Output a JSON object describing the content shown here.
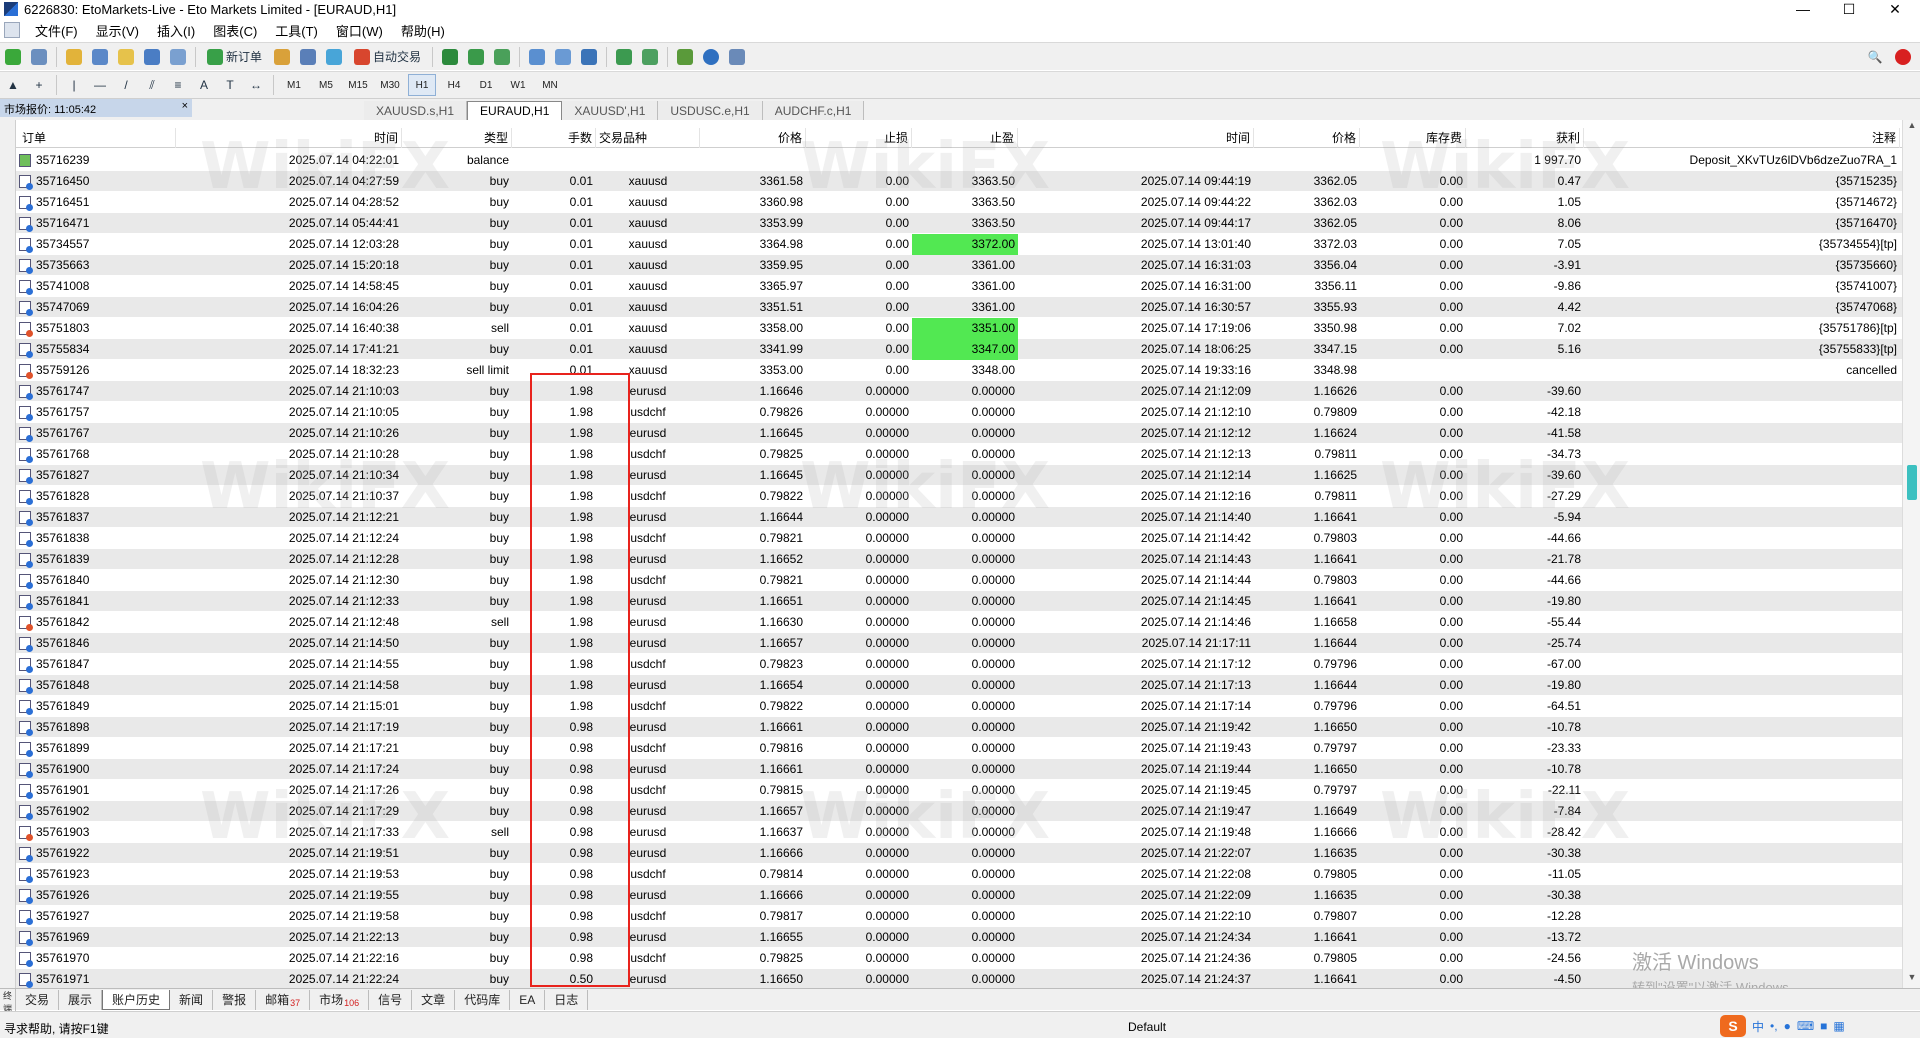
{
  "window": {
    "title": "6226830: EtoMarkets-Live - Eto Markets Limited - [EURAUD,H1]",
    "controls": [
      "—",
      "☐",
      "✕"
    ]
  },
  "menu": [
    "文件(F)",
    "显示(V)",
    "插入(I)",
    "图表(C)",
    "工具(T)",
    "窗口(W)",
    "帮助(H)"
  ],
  "toolbar": {
    "new_order": "新订单",
    "auto_trade": "自动交易",
    "timeframes": [
      "M1",
      "M5",
      "M15",
      "M30",
      "H1",
      "H4",
      "D1",
      "W1",
      "MN"
    ],
    "active_timeframe": "H1"
  },
  "market_watch": {
    "header": "市场报价: 11:05:42",
    "close": "×"
  },
  "chart_tabs": [
    "XAUUSD.s,H1",
    "EURAUD,H1",
    "XAUUSD',H1",
    "USDUSC.e,H1",
    "AUDCHF.c,H1"
  ],
  "active_chart_tab": "EURAUD,H1",
  "columns": [
    "订单",
    "时间",
    "类型",
    "手数",
    "交易品种",
    "价格",
    "止损",
    "止盈",
    "时间",
    "价格",
    "库存费",
    "获利",
    "注释"
  ],
  "rows": [
    {
      "order": "35716239",
      "open_time": "2025.07.14 04:22:01",
      "type": "balance",
      "lots": "",
      "symbol": "",
      "price": "",
      "sl": "",
      "tp": "",
      "close_time": "",
      "close_price": "",
      "swap": "",
      "profit": "1 997.70",
      "comment": "Deposit_XKvTUz6lDVb6dzeZuo7RA_1",
      "icon": "bal"
    },
    {
      "order": "35716450",
      "open_time": "2025.07.14 04:27:59",
      "type": "buy",
      "lots": "0.01",
      "symbol": "xauusd",
      "price": "3361.58",
      "sl": "0.00",
      "tp": "3363.50",
      "close_time": "2025.07.14 09:44:19",
      "close_price": "3362.05",
      "swap": "0.00",
      "profit": "0.47",
      "comment": "{35715235}",
      "icon": "buy"
    },
    {
      "order": "35716451",
      "open_time": "2025.07.14 04:28:52",
      "type": "buy",
      "lots": "0.01",
      "symbol": "xauusd",
      "price": "3360.98",
      "sl": "0.00",
      "tp": "3363.50",
      "close_time": "2025.07.14 09:44:22",
      "close_price": "3362.03",
      "swap": "0.00",
      "profit": "1.05",
      "comment": "{35714672}",
      "icon": "buy"
    },
    {
      "order": "35716471",
      "open_time": "2025.07.14 05:44:41",
      "type": "buy",
      "lots": "0.01",
      "symbol": "xauusd",
      "price": "3353.99",
      "sl": "0.00",
      "tp": "3363.50",
      "close_time": "2025.07.14 09:44:17",
      "close_price": "3362.05",
      "swap": "0.00",
      "profit": "8.06",
      "comment": "{35716470}",
      "icon": "buy"
    },
    {
      "order": "35734557",
      "open_time": "2025.07.14 12:03:28",
      "type": "buy",
      "lots": "0.01",
      "symbol": "xauusd",
      "price": "3364.98",
      "sl": "0.00",
      "tp": "3372.00",
      "close_time": "2025.07.14 13:01:40",
      "close_price": "3372.03",
      "swap": "0.00",
      "profit": "7.05",
      "comment": "{35734554}[tp]",
      "icon": "buy",
      "tp_hit": true
    },
    {
      "order": "35735663",
      "open_time": "2025.07.14 15:20:18",
      "type": "buy",
      "lots": "0.01",
      "symbol": "xauusd",
      "price": "3359.95",
      "sl": "0.00",
      "tp": "3361.00",
      "close_time": "2025.07.14 16:31:03",
      "close_price": "3356.04",
      "swap": "0.00",
      "profit": "-3.91",
      "comment": "{35735660}",
      "icon": "buy"
    },
    {
      "order": "35741008",
      "open_time": "2025.07.14 14:58:45",
      "type": "buy",
      "lots": "0.01",
      "symbol": "xauusd",
      "price": "3365.97",
      "sl": "0.00",
      "tp": "3361.00",
      "close_time": "2025.07.14 16:31:00",
      "close_price": "3356.11",
      "swap": "0.00",
      "profit": "-9.86",
      "comment": "{35741007}",
      "icon": "buy"
    },
    {
      "order": "35747069",
      "open_time": "2025.07.14 16:04:26",
      "type": "buy",
      "lots": "0.01",
      "symbol": "xauusd",
      "price": "3351.51",
      "sl": "0.00",
      "tp": "3361.00",
      "close_time": "2025.07.14 16:30:57",
      "close_price": "3355.93",
      "swap": "0.00",
      "profit": "4.42",
      "comment": "{35747068}",
      "icon": "buy"
    },
    {
      "order": "35751803",
      "open_time": "2025.07.14 16:40:38",
      "type": "sell",
      "lots": "0.01",
      "symbol": "xauusd",
      "price": "3358.00",
      "sl": "0.00",
      "tp": "3351.00",
      "close_time": "2025.07.14 17:19:06",
      "close_price": "3350.98",
      "swap": "0.00",
      "profit": "7.02",
      "comment": "{35751786}[tp]",
      "icon": "sell",
      "tp_hit": true
    },
    {
      "order": "35755834",
      "open_time": "2025.07.14 17:41:21",
      "type": "buy",
      "lots": "0.01",
      "symbol": "xauusd",
      "price": "3341.99",
      "sl": "0.00",
      "tp": "3347.00",
      "close_time": "2025.07.14 18:06:25",
      "close_price": "3347.15",
      "swap": "0.00",
      "profit": "5.16",
      "comment": "{35755833}[tp]",
      "icon": "buy",
      "tp_hit": true
    },
    {
      "order": "35759126",
      "open_time": "2025.07.14 18:32:23",
      "type": "sell limit",
      "lots": "0.01",
      "symbol": "xauusd",
      "price": "3353.00",
      "sl": "0.00",
      "tp": "3348.00",
      "close_time": "2025.07.14 19:33:16",
      "close_price": "3348.98",
      "swap": "",
      "profit": "",
      "comment": "cancelled",
      "icon": "sell"
    },
    {
      "order": "35761747",
      "open_time": "2025.07.14 21:10:03",
      "type": "buy",
      "lots": "1.98",
      "symbol": "eurusd",
      "price": "1.16646",
      "sl": "0.00000",
      "tp": "0.00000",
      "close_time": "2025.07.14 21:12:09",
      "close_price": "1.16626",
      "swap": "0.00",
      "profit": "-39.60",
      "comment": "",
      "icon": "buy"
    },
    {
      "order": "35761757",
      "open_time": "2025.07.14 21:10:05",
      "type": "buy",
      "lots": "1.98",
      "symbol": "usdchf",
      "price": "0.79826",
      "sl": "0.00000",
      "tp": "0.00000",
      "close_time": "2025.07.14 21:12:10",
      "close_price": "0.79809",
      "swap": "0.00",
      "profit": "-42.18",
      "comment": "",
      "icon": "buy"
    },
    {
      "order": "35761767",
      "open_time": "2025.07.14 21:10:26",
      "type": "buy",
      "lots": "1.98",
      "symbol": "eurusd",
      "price": "1.16645",
      "sl": "0.00000",
      "tp": "0.00000",
      "close_time": "2025.07.14 21:12:12",
      "close_price": "1.16624",
      "swap": "0.00",
      "profit": "-41.58",
      "comment": "",
      "icon": "buy"
    },
    {
      "order": "35761768",
      "open_time": "2025.07.14 21:10:28",
      "type": "buy",
      "lots": "1.98",
      "symbol": "usdchf",
      "price": "0.79825",
      "sl": "0.00000",
      "tp": "0.00000",
      "close_time": "2025.07.14 21:12:13",
      "close_price": "0.79811",
      "swap": "0.00",
      "profit": "-34.73",
      "comment": "",
      "icon": "buy"
    },
    {
      "order": "35761827",
      "open_time": "2025.07.14 21:10:34",
      "type": "buy",
      "lots": "1.98",
      "symbol": "eurusd",
      "price": "1.16645",
      "sl": "0.00000",
      "tp": "0.00000",
      "close_time": "2025.07.14 21:12:14",
      "close_price": "1.16625",
      "swap": "0.00",
      "profit": "-39.60",
      "comment": "",
      "icon": "buy"
    },
    {
      "order": "35761828",
      "open_time": "2025.07.14 21:10:37",
      "type": "buy",
      "lots": "1.98",
      "symbol": "usdchf",
      "price": "0.79822",
      "sl": "0.00000",
      "tp": "0.00000",
      "close_time": "2025.07.14 21:12:16",
      "close_price": "0.79811",
      "swap": "0.00",
      "profit": "-27.29",
      "comment": "",
      "icon": "buy"
    },
    {
      "order": "35761837",
      "open_time": "2025.07.14 21:12:21",
      "type": "buy",
      "lots": "1.98",
      "symbol": "eurusd",
      "price": "1.16644",
      "sl": "0.00000",
      "tp": "0.00000",
      "close_time": "2025.07.14 21:14:40",
      "close_price": "1.16641",
      "swap": "0.00",
      "profit": "-5.94",
      "comment": "",
      "icon": "buy"
    },
    {
      "order": "35761838",
      "open_time": "2025.07.14 21:12:24",
      "type": "buy",
      "lots": "1.98",
      "symbol": "usdchf",
      "price": "0.79821",
      "sl": "0.00000",
      "tp": "0.00000",
      "close_time": "2025.07.14 21:14:42",
      "close_price": "0.79803",
      "swap": "0.00",
      "profit": "-44.66",
      "comment": "",
      "icon": "buy"
    },
    {
      "order": "35761839",
      "open_time": "2025.07.14 21:12:28",
      "type": "buy",
      "lots": "1.98",
      "symbol": "eurusd",
      "price": "1.16652",
      "sl": "0.00000",
      "tp": "0.00000",
      "close_time": "2025.07.14 21:14:43",
      "close_price": "1.16641",
      "swap": "0.00",
      "profit": "-21.78",
      "comment": "",
      "icon": "buy"
    },
    {
      "order": "35761840",
      "open_time": "2025.07.14 21:12:30",
      "type": "buy",
      "lots": "1.98",
      "symbol": "usdchf",
      "price": "0.79821",
      "sl": "0.00000",
      "tp": "0.00000",
      "close_time": "2025.07.14 21:14:44",
      "close_price": "0.79803",
      "swap": "0.00",
      "profit": "-44.66",
      "comment": "",
      "icon": "buy"
    },
    {
      "order": "35761841",
      "open_time": "2025.07.14 21:12:33",
      "type": "buy",
      "lots": "1.98",
      "symbol": "eurusd",
      "price": "1.16651",
      "sl": "0.00000",
      "tp": "0.00000",
      "close_time": "2025.07.14 21:14:45",
      "close_price": "1.16641",
      "swap": "0.00",
      "profit": "-19.80",
      "comment": "",
      "icon": "buy"
    },
    {
      "order": "35761842",
      "open_time": "2025.07.14 21:12:48",
      "type": "sell",
      "lots": "1.98",
      "symbol": "eurusd",
      "price": "1.16630",
      "sl": "0.00000",
      "tp": "0.00000",
      "close_time": "2025.07.14 21:14:46",
      "close_price": "1.16658",
      "swap": "0.00",
      "profit": "-55.44",
      "comment": "",
      "icon": "sell"
    },
    {
      "order": "35761846",
      "open_time": "2025.07.14 21:14:50",
      "type": "buy",
      "lots": "1.98",
      "symbol": "eurusd",
      "price": "1.16657",
      "sl": "0.00000",
      "tp": "0.00000",
      "close_time": "2025.07.14 21:17:11",
      "close_price": "1.16644",
      "swap": "0.00",
      "profit": "-25.74",
      "comment": "",
      "icon": "buy"
    },
    {
      "order": "35761847",
      "open_time": "2025.07.14 21:14:55",
      "type": "buy",
      "lots": "1.98",
      "symbol": "usdchf",
      "price": "0.79823",
      "sl": "0.00000",
      "tp": "0.00000",
      "close_time": "2025.07.14 21:17:12",
      "close_price": "0.79796",
      "swap": "0.00",
      "profit": "-67.00",
      "comment": "",
      "icon": "buy"
    },
    {
      "order": "35761848",
      "open_time": "2025.07.14 21:14:58",
      "type": "buy",
      "lots": "1.98",
      "symbol": "eurusd",
      "price": "1.16654",
      "sl": "0.00000",
      "tp": "0.00000",
      "close_time": "2025.07.14 21:17:13",
      "close_price": "1.16644",
      "swap": "0.00",
      "profit": "-19.80",
      "comment": "",
      "icon": "buy"
    },
    {
      "order": "35761849",
      "open_time": "2025.07.14 21:15:01",
      "type": "buy",
      "lots": "1.98",
      "symbol": "usdchf",
      "price": "0.79822",
      "sl": "0.00000",
      "tp": "0.00000",
      "close_time": "2025.07.14 21:17:14",
      "close_price": "0.79796",
      "swap": "0.00",
      "profit": "-64.51",
      "comment": "",
      "icon": "buy"
    },
    {
      "order": "35761898",
      "open_time": "2025.07.14 21:17:19",
      "type": "buy",
      "lots": "0.98",
      "symbol": "eurusd",
      "price": "1.16661",
      "sl": "0.00000",
      "tp": "0.00000",
      "close_time": "2025.07.14 21:19:42",
      "close_price": "1.16650",
      "swap": "0.00",
      "profit": "-10.78",
      "comment": "",
      "icon": "buy"
    },
    {
      "order": "35761899",
      "open_time": "2025.07.14 21:17:21",
      "type": "buy",
      "lots": "0.98",
      "symbol": "usdchf",
      "price": "0.79816",
      "sl": "0.00000",
      "tp": "0.00000",
      "close_time": "2025.07.14 21:19:43",
      "close_price": "0.79797",
      "swap": "0.00",
      "profit": "-23.33",
      "comment": "",
      "icon": "buy"
    },
    {
      "order": "35761900",
      "open_time": "2025.07.14 21:17:24",
      "type": "buy",
      "lots": "0.98",
      "symbol": "eurusd",
      "price": "1.16661",
      "sl": "0.00000",
      "tp": "0.00000",
      "close_time": "2025.07.14 21:19:44",
      "close_price": "1.16650",
      "swap": "0.00",
      "profit": "-10.78",
      "comment": "",
      "icon": "buy"
    },
    {
      "order": "35761901",
      "open_time": "2025.07.14 21:17:26",
      "type": "buy",
      "lots": "0.98",
      "symbol": "usdchf",
      "price": "0.79815",
      "sl": "0.00000",
      "tp": "0.00000",
      "close_time": "2025.07.14 21:19:45",
      "close_price": "0.79797",
      "swap": "0.00",
      "profit": "-22.11",
      "comment": "",
      "icon": "buy"
    },
    {
      "order": "35761902",
      "open_time": "2025.07.14 21:17:29",
      "type": "buy",
      "lots": "0.98",
      "symbol": "eurusd",
      "price": "1.16657",
      "sl": "0.00000",
      "tp": "0.00000",
      "close_time": "2025.07.14 21:19:47",
      "close_price": "1.16649",
      "swap": "0.00",
      "profit": "-7.84",
      "comment": "",
      "icon": "buy"
    },
    {
      "order": "35761903",
      "open_time": "2025.07.14 21:17:33",
      "type": "sell",
      "lots": "0.98",
      "symbol": "eurusd",
      "price": "1.16637",
      "sl": "0.00000",
      "tp": "0.00000",
      "close_time": "2025.07.14 21:19:48",
      "close_price": "1.16666",
      "swap": "0.00",
      "profit": "-28.42",
      "comment": "",
      "icon": "sell"
    },
    {
      "order": "35761922",
      "open_time": "2025.07.14 21:19:51",
      "type": "buy",
      "lots": "0.98",
      "symbol": "eurusd",
      "price": "1.16666",
      "sl": "0.00000",
      "tp": "0.00000",
      "close_time": "2025.07.14 21:22:07",
      "close_price": "1.16635",
      "swap": "0.00",
      "profit": "-30.38",
      "comment": "",
      "icon": "buy"
    },
    {
      "order": "35761923",
      "open_time": "2025.07.14 21:19:53",
      "type": "buy",
      "lots": "0.98",
      "symbol": "usdchf",
      "price": "0.79814",
      "sl": "0.00000",
      "tp": "0.00000",
      "close_time": "2025.07.14 21:22:08",
      "close_price": "0.79805",
      "swap": "0.00",
      "profit": "-11.05",
      "comment": "",
      "icon": "buy"
    },
    {
      "order": "35761926",
      "open_time": "2025.07.14 21:19:55",
      "type": "buy",
      "lots": "0.98",
      "symbol": "eurusd",
      "price": "1.16666",
      "sl": "0.00000",
      "tp": "0.00000",
      "close_time": "2025.07.14 21:22:09",
      "close_price": "1.16635",
      "swap": "0.00",
      "profit": "-30.38",
      "comment": "",
      "icon": "buy"
    },
    {
      "order": "35761927",
      "open_time": "2025.07.14 21:19:58",
      "type": "buy",
      "lots": "0.98",
      "symbol": "usdchf",
      "price": "0.79817",
      "sl": "0.00000",
      "tp": "0.00000",
      "close_time": "2025.07.14 21:22:10",
      "close_price": "0.79807",
      "swap": "0.00",
      "profit": "-12.28",
      "comment": "",
      "icon": "buy"
    },
    {
      "order": "35761969",
      "open_time": "2025.07.14 21:22:13",
      "type": "buy",
      "lots": "0.98",
      "symbol": "eurusd",
      "price": "1.16655",
      "sl": "0.00000",
      "tp": "0.00000",
      "close_time": "2025.07.14 21:24:34",
      "close_price": "1.16641",
      "swap": "0.00",
      "profit": "-13.72",
      "comment": "",
      "icon": "buy"
    },
    {
      "order": "35761970",
      "open_time": "2025.07.14 21:22:16",
      "type": "buy",
      "lots": "0.98",
      "symbol": "usdchf",
      "price": "0.79825",
      "sl": "0.00000",
      "tp": "0.00000",
      "close_time": "2025.07.14 21:24:36",
      "close_price": "0.79805",
      "swap": "0.00",
      "profit": "-24.56",
      "comment": "",
      "icon": "buy"
    },
    {
      "order": "35761971",
      "open_time": "2025.07.14 21:22:24",
      "type": "buy",
      "lots": "0.50",
      "symbol": "eurusd",
      "price": "1.16650",
      "sl": "0.00000",
      "tp": "0.00000",
      "close_time": "2025.07.14 21:24:37",
      "close_price": "1.16641",
      "swap": "0.00",
      "profit": "-4.50",
      "comment": "",
      "icon": "buy"
    }
  ],
  "terminal_label": "终端",
  "bottom_tabs": [
    {
      "label": "交易",
      "count": ""
    },
    {
      "label": "展示",
      "count": ""
    },
    {
      "label": "账户历史",
      "count": ""
    },
    {
      "label": "新闻",
      "count": ""
    },
    {
      "label": "警报",
      "count": ""
    },
    {
      "label": "邮箱",
      "count": "37"
    },
    {
      "label": "市场",
      "count": "106"
    },
    {
      "label": "信号",
      "count": ""
    },
    {
      "label": "文章",
      "count": ""
    },
    {
      "label": "代码库",
      "count": ""
    },
    {
      "label": "EA",
      "count": ""
    },
    {
      "label": "日志",
      "count": ""
    }
  ],
  "active_bottom_tab": "账户历史",
  "watermark": "WikiFX",
  "activation": {
    "line1": "激活 Windows",
    "line2": "转到\"设置\"以激活 Windows。"
  },
  "status": {
    "help": "寻求帮助, 请按F1键",
    "profile": "Default",
    "ime_lang": "中"
  },
  "colors": {
    "tp_highlight": "#52e852",
    "annotation_box": "#e8231d",
    "alt_row": "#e9e9e9"
  }
}
